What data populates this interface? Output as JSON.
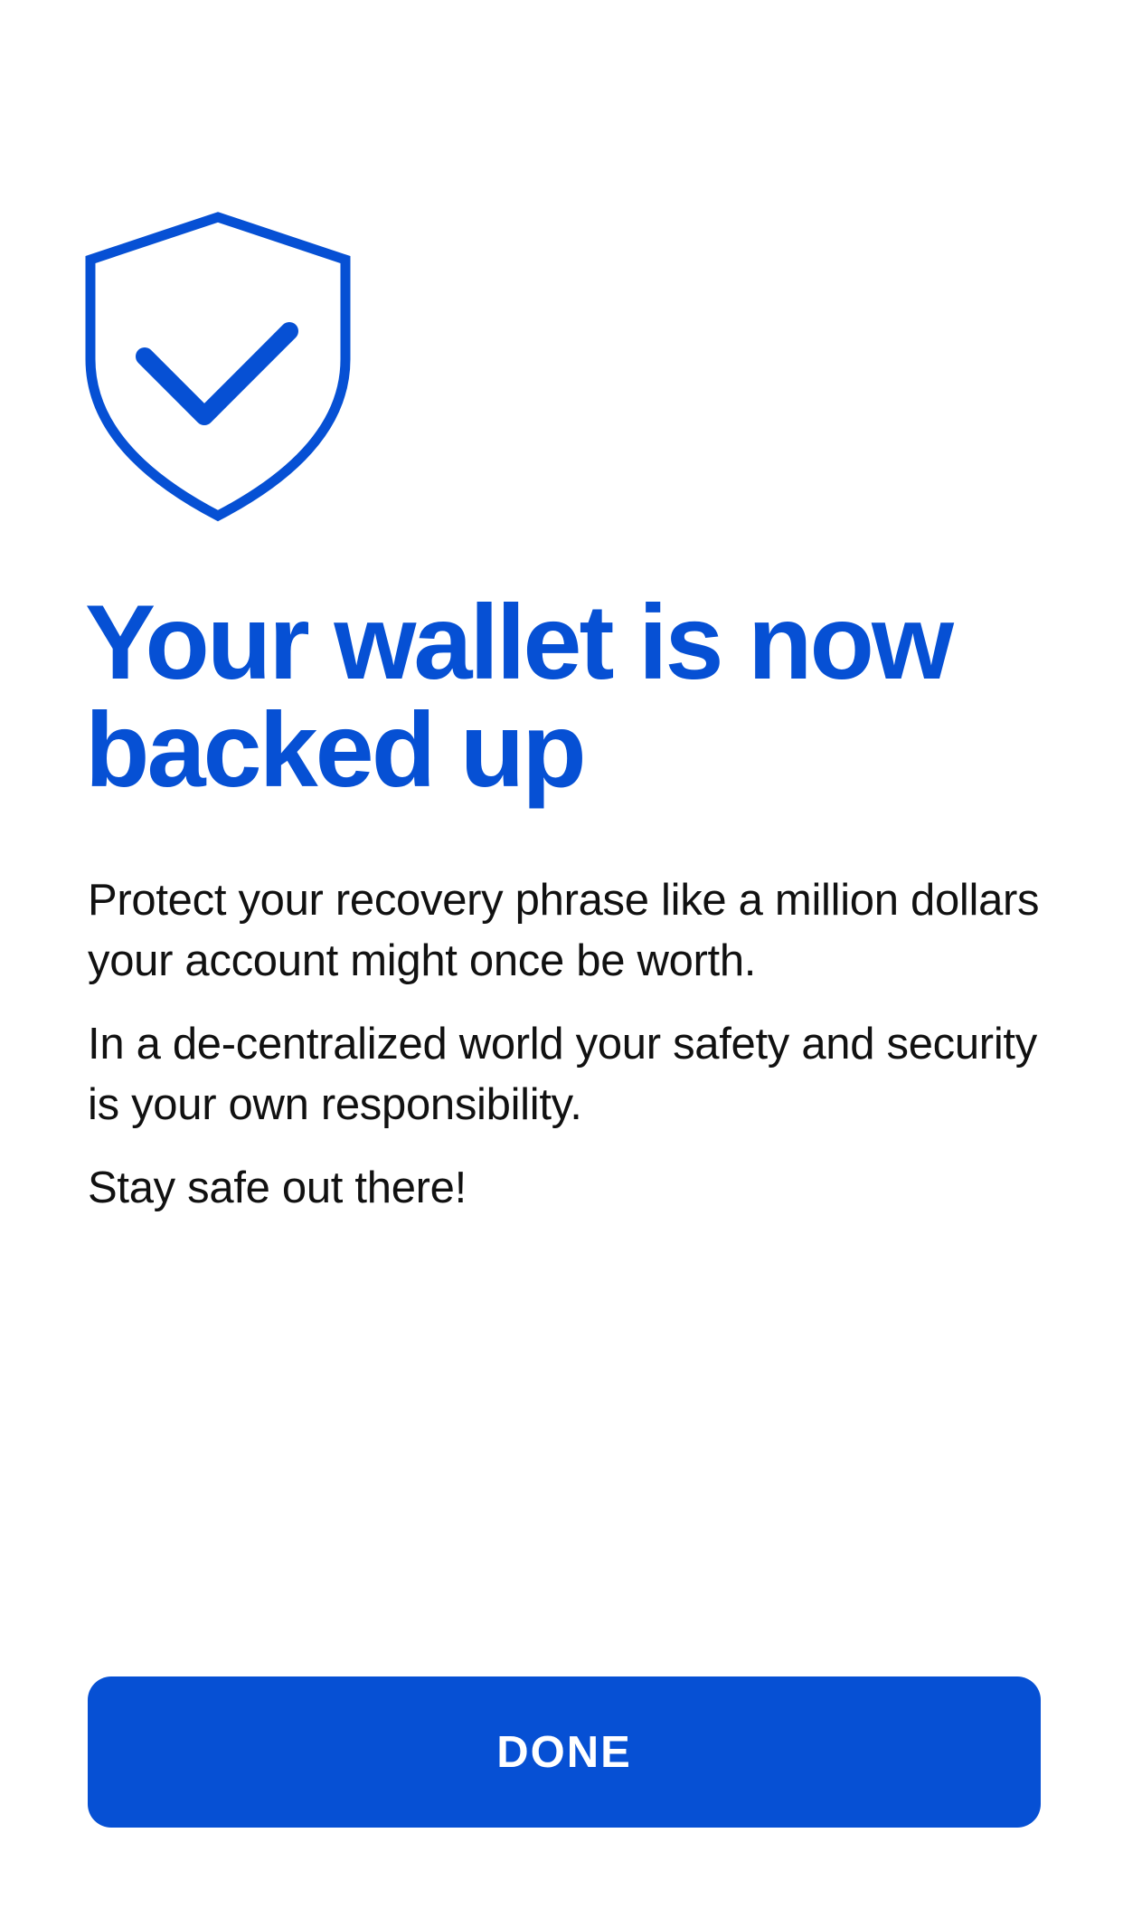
{
  "header": {
    "icon": "shield-check-icon",
    "title_line1": "Your wallet is now",
    "title_line2": "backed up"
  },
  "body": {
    "paragraphs": [
      "Protect your recovery phrase like a million dollars your account might once be worth.",
      "In a de-centralized world your safety and security is your own responsibility.",
      "Stay safe out there!"
    ]
  },
  "footer": {
    "done_label": "DONE"
  },
  "colors": {
    "accent": "#0650d4",
    "text": "#111111",
    "background": "#ffffff"
  }
}
